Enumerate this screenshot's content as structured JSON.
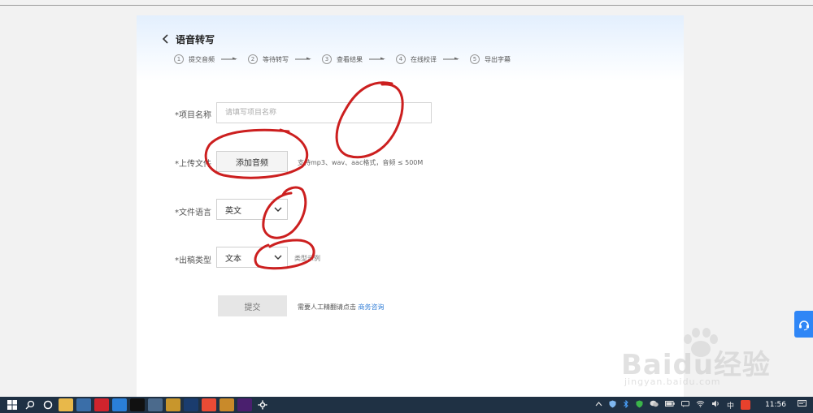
{
  "header": {
    "title": "语音转写",
    "steps": [
      {
        "num": "1",
        "label": "提交音频"
      },
      {
        "num": "2",
        "label": "等待转写"
      },
      {
        "num": "3",
        "label": "查看结果"
      },
      {
        "num": "4",
        "label": "在线校译"
      },
      {
        "num": "5",
        "label": "导出字幕"
      }
    ]
  },
  "form": {
    "project_name_label": "*项目名称",
    "project_name_placeholder": "请填写项目名称",
    "project_name_value": "",
    "upload_label": "*上传文件",
    "upload_button": "添加音频",
    "upload_hint": "支持mp3、wav、aac格式，音频 ≤ 500M",
    "language_label": "*文件语言",
    "language_value": "英文",
    "output_label": "*出稿类型",
    "output_value": "文本",
    "output_hint": "类型示例",
    "submit_button": "提交",
    "submit_note": "需要人工精翻请点击",
    "submit_link": "商务咨询"
  },
  "watermark": {
    "brand": "Baidu经验",
    "url": "jingyan.baidu.com"
  },
  "taskbar": {
    "icons": [
      "windows-start-icon",
      "search-icon",
      "cortana-icon",
      "file-explorer-icon",
      "app-icon",
      "netease-music-icon",
      "uplay-icon",
      "ide-icon",
      "mail-icon",
      "app-icon",
      "photoshop-icon",
      "chrome-icon",
      "wechat-icon",
      "premiere-icon",
      "settings-icon"
    ],
    "tray": {
      "ime": "中",
      "time": "11:56"
    }
  },
  "colors": {
    "accent": "#2f7cd6",
    "annotation": "#cc1f1f",
    "taskbar": "#1f3144",
    "help_tab": "#2f86f6"
  }
}
